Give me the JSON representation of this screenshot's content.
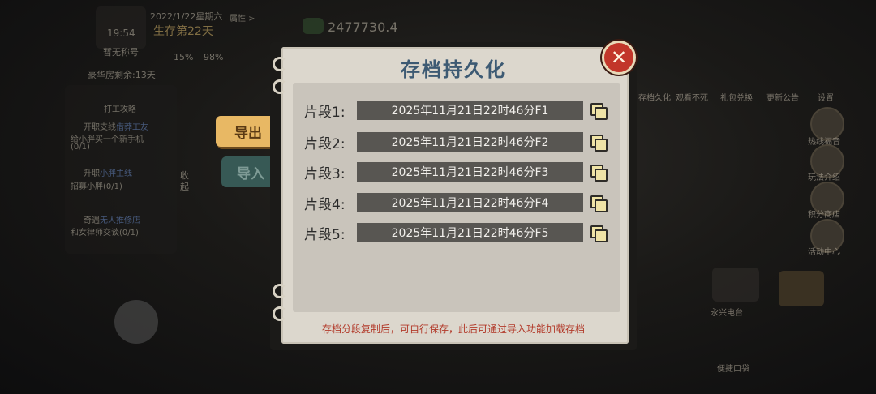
{
  "hud": {
    "date": "2022/1/22星期六",
    "survival_day": "生存第22天",
    "clock": "19:54",
    "title_tag": "暂无称号",
    "attr_button": "属性 >",
    "money": "2477730.4",
    "percent_1": "15%",
    "percent_2": "98%",
    "luxury_room": "豪华房剩余:13天",
    "work_strategy": "打工攻略"
  },
  "tasks": [
    {
      "head": "开职支线",
      "highlight": "借莽工友",
      "body": "给小胖买一个新手机",
      "progress": "(0/1)"
    },
    {
      "head": "升职",
      "highlight": "小胖主线",
      "body": "招募小胖(0/1)",
      "progress": ""
    },
    {
      "head": "奇遇",
      "highlight": "无人推修店",
      "body": "和女律师交谈(0/1)",
      "progress": ""
    }
  ],
  "collapse_label": "收起",
  "right_menu": {
    "top": [
      "存档久化",
      "观看不死",
      "礼包兑换",
      "更新公告",
      "设置"
    ],
    "side": [
      "热线福音",
      "玩法介绍",
      "积分商店",
      "活动中心"
    ],
    "yongxing_tv": "永兴电台",
    "shortcut": "便捷口袋"
  },
  "modal": {
    "title": "存档持久化",
    "tabs": {
      "export": "导出",
      "import": "导入"
    },
    "close_symbol": "✕",
    "rows": [
      {
        "label": "片段1:",
        "value": "2025年11月21日22时46分F1"
      },
      {
        "label": "片段2:",
        "value": "2025年11月21日22时46分F2"
      },
      {
        "label": "片段3:",
        "value": "2025年11月21日22时46分F3"
      },
      {
        "label": "片段4:",
        "value": "2025年11月21日22时46分F4"
      },
      {
        "label": "片段5:",
        "value": "2025年11月21日22时46分F5"
      }
    ],
    "copy_icon": "copy-icon",
    "footer_note": "存档分段复制后，可自行保存，此后可通过导入功能加载存档"
  },
  "colors": {
    "title": "#3d5a73",
    "row_bg": "#585652",
    "close_red": "#c2362a",
    "note_red": "#b23a2a",
    "export_tab": "#e8b864",
    "import_tab": "#3c6460"
  }
}
